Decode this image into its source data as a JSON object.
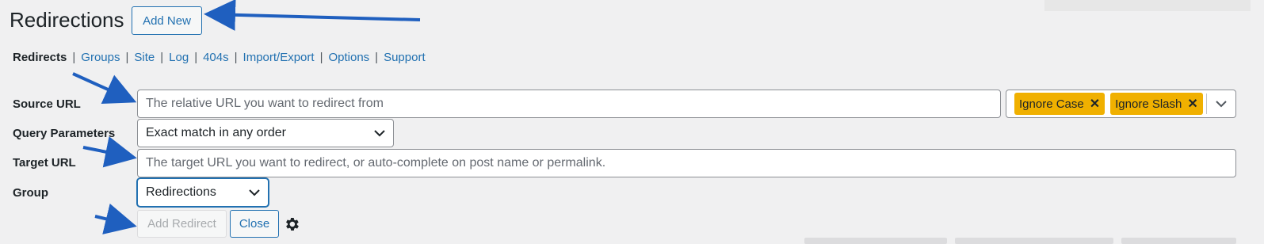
{
  "header": {
    "title": "Redirections",
    "add_new_label": "Add New"
  },
  "subnav": {
    "items": [
      {
        "label": "Redirects",
        "current": true
      },
      {
        "label": "Groups"
      },
      {
        "label": "Site"
      },
      {
        "label": "Log"
      },
      {
        "label": "404s"
      },
      {
        "label": "Import/Export"
      },
      {
        "label": "Options"
      },
      {
        "label": "Support"
      }
    ],
    "separator": "|"
  },
  "form": {
    "source_url": {
      "label": "Source URL",
      "placeholder": "The relative URL you want to redirect from",
      "value": ""
    },
    "flags": {
      "tags": [
        {
          "label": "Ignore Case",
          "remove": "✕"
        },
        {
          "label": "Ignore Slash",
          "remove": "✕"
        }
      ]
    },
    "query_parameters": {
      "label": "Query Parameters",
      "selected": "Exact match in any order"
    },
    "target_url": {
      "label": "Target URL",
      "placeholder": "The target URL you want to redirect, or auto-complete on post name or permalink.",
      "value": ""
    },
    "group": {
      "label": "Group",
      "selected": "Redirections"
    },
    "actions": {
      "add_redirect_label": "Add Redirect",
      "close_label": "Close"
    }
  },
  "icons": {
    "chevron": "chevron-down-icon",
    "gear": "gear-icon",
    "remove": "close-icon"
  },
  "colors": {
    "accent": "#2271b1",
    "tag_bg": "#f0b000",
    "page_bg": "#f0f0f1",
    "annotation_arrow": "#1f5fbf"
  }
}
